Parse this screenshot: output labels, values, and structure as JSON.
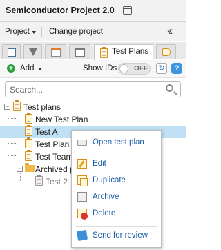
{
  "titlebar": {
    "title": "Semiconductor Project 2.0",
    "icon": "window-icon"
  },
  "projbar": {
    "project_label": "Project",
    "change_label": "Change project",
    "collapse_icon": "double-chevron-left-icon"
  },
  "tabs": [
    {
      "icon": "list-icon"
    },
    {
      "icon": "filter-icon"
    },
    {
      "icon": "calendar-icon"
    },
    {
      "icon": "panel-icon"
    },
    {
      "icon": "clipboard-icon",
      "label": "Test Plans",
      "active": true
    },
    {
      "icon": "tag-icon"
    }
  ],
  "toolbar": {
    "add_label": "Add",
    "show_ids_label": "Show IDs",
    "toggle_state": "OFF",
    "refresh_icon": "refresh-icon",
    "help_icon": "help-icon",
    "help_glyph": "?"
  },
  "search": {
    "placeholder": "Search..."
  },
  "tree": {
    "root": {
      "label": "Test plans",
      "expanded": true
    },
    "items": [
      {
        "label": "New Test Plan"
      },
      {
        "label": "Test A",
        "selected": true
      },
      {
        "label": "Test Plan n"
      },
      {
        "label": "Test Team"
      }
    ],
    "archived": {
      "label": "Archived pl",
      "expanded": true,
      "children": [
        {
          "label": "Test 2"
        }
      ]
    }
  },
  "context_menu": {
    "items": [
      {
        "label": "Open test plan",
        "icon": "open-icon"
      },
      {
        "label": "Edit",
        "icon": "edit-icon"
      },
      {
        "label": "Duplicate",
        "icon": "duplicate-icon"
      },
      {
        "label": "Archive",
        "icon": "archive-icon"
      },
      {
        "label": "Delete",
        "icon": "delete-icon"
      },
      {
        "label": "Send for review",
        "icon": "send-icon"
      }
    ]
  },
  "colors": {
    "selection": "#bfe0f5",
    "menu_text": "#1a5ea8",
    "add_green": "#2f9e3c",
    "help_blue": "#3d94df"
  }
}
